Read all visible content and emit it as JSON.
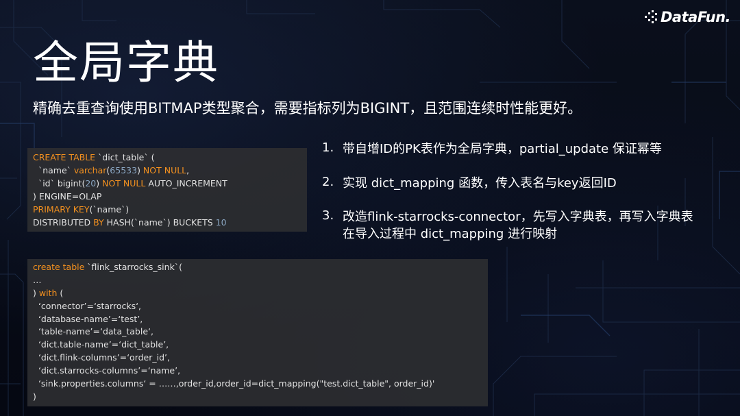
{
  "logo": {
    "text": "DataFun."
  },
  "title": "全局字典",
  "subtitle": "精确去重查询使用BITMAP类型聚合，需要指标列为BIGINT，且范围连续时性能更好。",
  "code_block_1": [
    [
      {
        "t": "CREATE TABLE",
        "s": "kw"
      },
      {
        "t": " `dict_table` (",
        "s": "text"
      }
    ],
    [
      {
        "t": "  `name` ",
        "s": "text"
      },
      {
        "t": "varchar",
        "s": "kw"
      },
      {
        "t": "(",
        "s": "text"
      },
      {
        "t": "65533",
        "s": "num"
      },
      {
        "t": ") ",
        "s": "text"
      },
      {
        "t": "NOT NULL",
        "s": "kw"
      },
      {
        "t": ",",
        "s": "text"
      }
    ],
    [
      {
        "t": "  `id` bigint(",
        "s": "text"
      },
      {
        "t": "20",
        "s": "num"
      },
      {
        "t": ") ",
        "s": "text"
      },
      {
        "t": "NOT NULL",
        "s": "kw"
      },
      {
        "t": " AUTO_INCREMENT",
        "s": "text"
      }
    ],
    [
      {
        "t": ") ENGINE=OLAP",
        "s": "text"
      }
    ],
    [
      {
        "t": "PRIMARY KEY",
        "s": "kw"
      },
      {
        "t": "(`name`)",
        "s": "text"
      }
    ],
    [
      {
        "t": "DISTRIBUTED ",
        "s": "text"
      },
      {
        "t": "BY",
        "s": "kw"
      },
      {
        "t": " HASH(`name`) BUCKETS ",
        "s": "text"
      },
      {
        "t": "10",
        "s": "num"
      }
    ]
  ],
  "steps": [
    {
      "num": "1.",
      "lines": [
        "带自增ID的PK表作为全局字典，partial_update 保证幂等"
      ]
    },
    {
      "num": "2.",
      "lines": [
        "实现 dict_mapping 函数，传入表名与key返回ID"
      ]
    },
    {
      "num": "3.",
      "lines": [
        "改造flink-starrocks-connector，先写入字典表，再写入字典表",
        "在导入过程中 dict_mapping 进行映射"
      ]
    }
  ],
  "code_block_2": [
    [
      {
        "t": "create table",
        "s": "kw"
      },
      {
        "t": " `flink_starrocks_sink`(",
        "s": "text"
      }
    ],
    [
      {
        "t": "…",
        "s": "text"
      }
    ],
    [
      {
        "t": ") ",
        "s": "text"
      },
      {
        "t": "with",
        "s": "kw"
      },
      {
        "t": " (",
        "s": "text"
      }
    ],
    [
      {
        "t": "  ‘connector’=‘starrocks‘,",
        "s": "text"
      }
    ],
    [
      {
        "t": "  ‘database-name’=‘test’,",
        "s": "text"
      }
    ],
    [
      {
        "t": "  ‘table-name’=‘data_table‘,",
        "s": "text"
      }
    ],
    [
      {
        "t": "  ‘dict.table-name’=‘dict_table’,",
        "s": "text"
      }
    ],
    [
      {
        "t": "  ‘dict.flink-columns’=‘order_id’,",
        "s": "text"
      }
    ],
    [
      {
        "t": "  ‘dict.starrocks-columns’=‘name’,",
        "s": "text"
      }
    ],
    [
      {
        "t": "  ‘sink.properties.columns‘ = ……,order_id,order_id=dict_mapping(\"test.dict_table\", order_id)'",
        "s": "text"
      }
    ],
    [
      {
        "t": ")",
        "s": "text"
      }
    ]
  ],
  "colors": {
    "background": "#060a14",
    "code_background": "#2c2d30",
    "code_text": "#e2e2e2",
    "keyword": "#f4911f",
    "number": "#8aa6c2",
    "heading": "#ffffff"
  }
}
